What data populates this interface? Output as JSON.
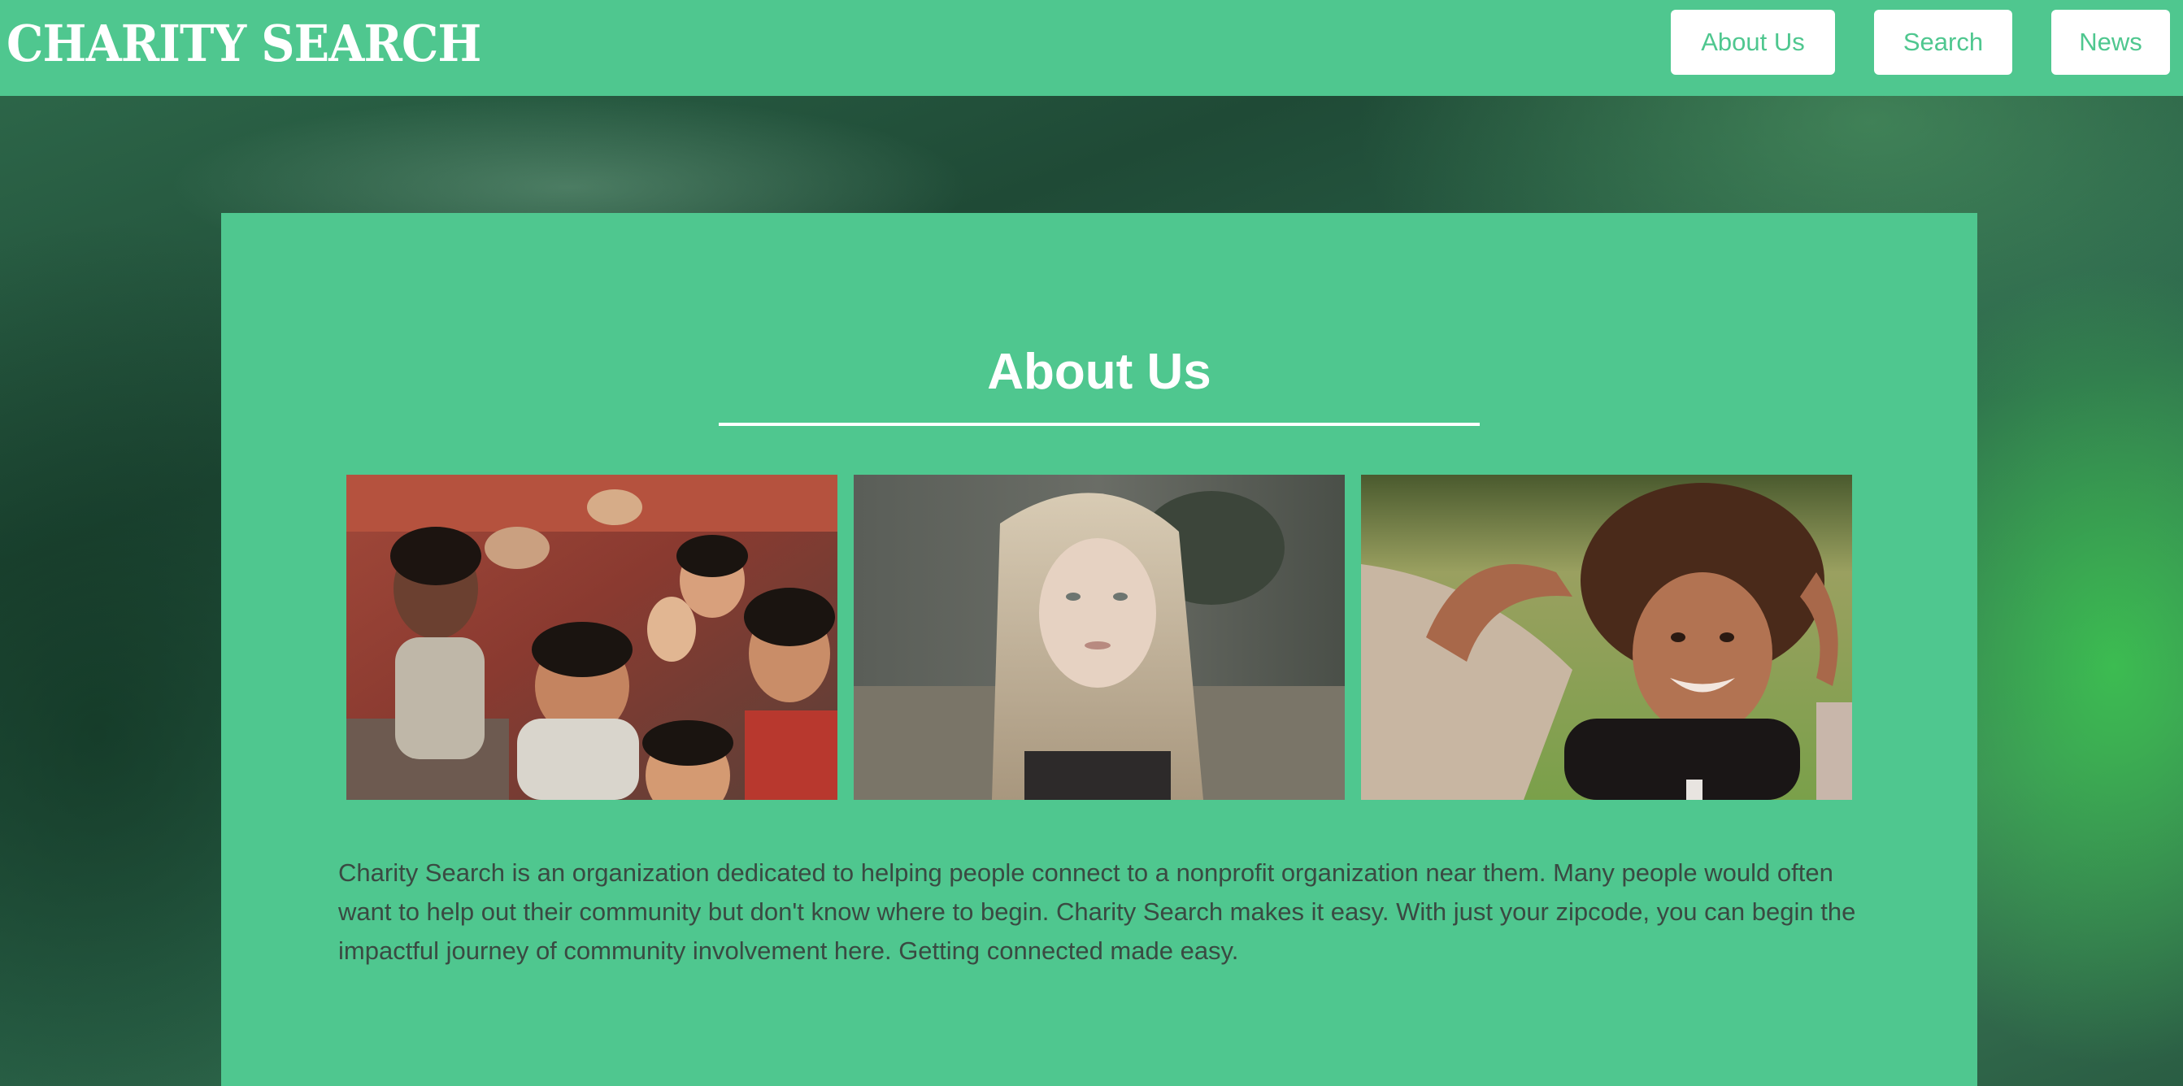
{
  "header": {
    "brand": "CHARITY SEARCH",
    "nav": {
      "about_label": "About Us",
      "search_label": "Search",
      "news_label": "News"
    }
  },
  "main": {
    "title": "About Us",
    "images": [
      {
        "alt": "group of smiling children making peace signs"
      },
      {
        "alt": "girl with long blonde hair looking up"
      },
      {
        "alt": "smiling girl with curly hair"
      }
    ],
    "description": "Charity Search is an organization dedicated to helping people connect to a nonprofit organization near them. Many people would often want to help out their community but don't know where to begin. Charity Search makes it easy. With just your zipcode, you can begin the impactful journey of community involvement here. Getting connected made easy."
  },
  "colors": {
    "brand_green": "#4fc78f",
    "white": "#ffffff",
    "body_text": "#3a4a42"
  }
}
